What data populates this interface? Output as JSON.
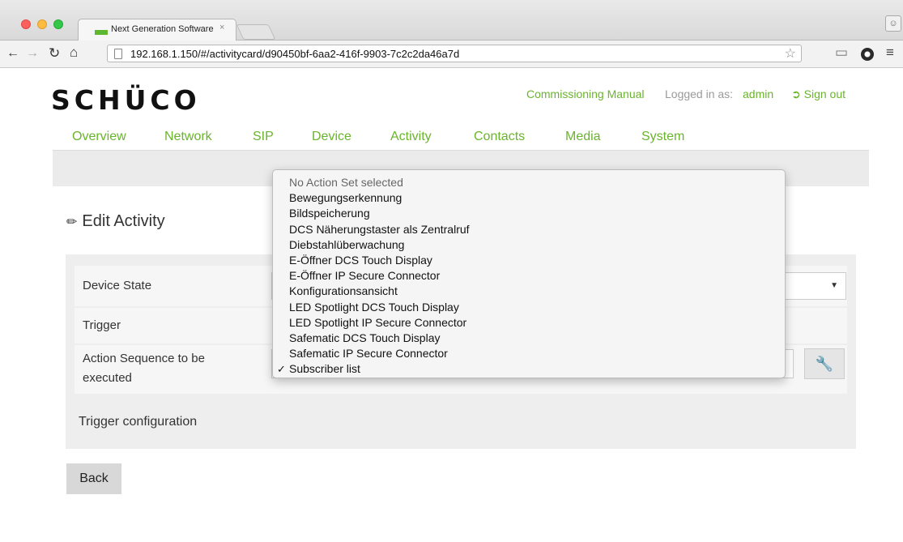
{
  "browser": {
    "tab_title": "Next Generation Software",
    "tab_close": "×",
    "url": "192.168.1.150/#/activitycard/d90450bf-6aa2-416f-9903-7c2c2da46a7d"
  },
  "header": {
    "logo": "SCHÜCO",
    "manual_link": "Commissioning Manual",
    "logged_in_label": "Logged in as:",
    "user": "admin",
    "sign_out": "Sign out"
  },
  "nav": {
    "items": [
      "Overview",
      "Network",
      "SIP",
      "Device",
      "Activity",
      "Contacts",
      "Media",
      "System"
    ]
  },
  "page": {
    "title": "Edit Activity",
    "rows": {
      "device_state": "Device State",
      "trigger": "Trigger",
      "action_sequence_line1": "Action Sequence to be",
      "action_sequence_line2": "executed"
    },
    "trigger_configuration": "Trigger configuration",
    "back_button": "Back"
  },
  "dropdown": {
    "placeholder": "No Action Set selected",
    "options": [
      "Bewegungserkennung",
      "Bildspeicherung",
      "DCS Näherungstaster als Zentralruf",
      "Diebstahlüberwachung",
      "E-Öffner DCS Touch Display",
      "E-Öffner IP Secure Connector",
      "Konfigurationsansicht",
      "LED Spotlight DCS Touch Display",
      "LED Spotlight IP Secure Connector",
      "Safematic DCS Touch Display",
      "Safematic IP Secure Connector"
    ],
    "selected": "Subscriber list",
    "check_mark": "✓"
  }
}
